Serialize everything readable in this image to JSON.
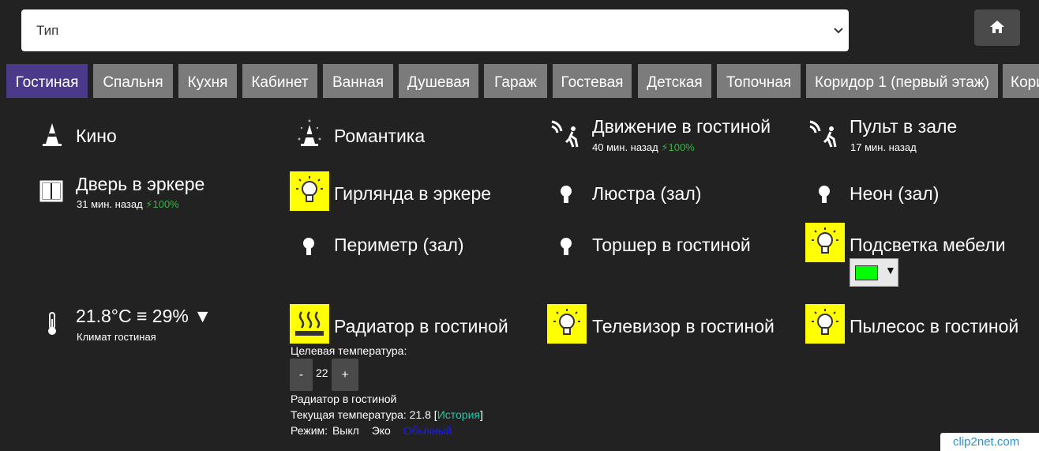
{
  "select": {
    "value": "Тип"
  },
  "tabs": [
    {
      "label": "Гостиная",
      "active": true
    },
    {
      "label": "Спальня"
    },
    {
      "label": "Кухня"
    },
    {
      "label": "Кабинет"
    },
    {
      "label": "Ванная"
    },
    {
      "label": "Душевая"
    },
    {
      "label": "Гараж"
    },
    {
      "label": "Гостевая"
    },
    {
      "label": "Детская"
    },
    {
      "label": "Топочная"
    },
    {
      "label": "Коридор 1 (первый этаж)"
    },
    {
      "label": "Кори"
    }
  ],
  "devices": {
    "kino": {
      "label": "Кино",
      "icon": "scene-cone-icon"
    },
    "romantika": {
      "label": "Романтика",
      "icon": "scene-cone-icon"
    },
    "motion_living": {
      "label": "Движение в гостиной",
      "time": "40 мин. назад",
      "battery": "100%",
      "icon": "motion-sensor-icon"
    },
    "remote_hall": {
      "label": "Пульт в зале",
      "time": "17 мин. назад",
      "icon": "motion-sensor-icon"
    },
    "door_bay": {
      "label": "Дверь в эркере",
      "time": "31 мин. назад",
      "battery": "100%",
      "icon": "door-icon"
    },
    "garland": {
      "label": "Гирлянда в эркере",
      "on": true,
      "icon": "bulb-icon"
    },
    "chandelier": {
      "label": "Люстра (зал)",
      "on": false,
      "icon": "bulb-icon"
    },
    "neon": {
      "label": "Неон (зал)",
      "on": false,
      "icon": "bulb-icon"
    },
    "perimeter": {
      "label": "Периметр (зал)",
      "on": false,
      "icon": "bulb-icon"
    },
    "floorlamp": {
      "label": "Торшер в гостиной",
      "on": false,
      "icon": "bulb-icon"
    },
    "furniture_light": {
      "label": "Подсветка мебели",
      "on": true,
      "color": "#00ff00",
      "icon": "bulb-icon"
    },
    "climate": {
      "label": "21.8°C ≡ 29% ▼",
      "sub": "Климат гостиная",
      "icon": "thermometer-icon"
    },
    "radiator": {
      "label": "Радиатор в гостиной",
      "on": true,
      "icon": "heater-icon",
      "target_label": "Целевая температура:",
      "minus": "-",
      "value": "22",
      "plus": "+",
      "name": "Радиатор в гостиной",
      "current_prefix": "Текущая температура: 21.8 [",
      "history": "История",
      "current_suffix": "]",
      "mode_label": "Режим:",
      "mode_off": "Выкл",
      "mode_eco": "Эко",
      "mode_normal": "Обычный"
    },
    "tv": {
      "label": "Телевизор в гостиной",
      "on": true,
      "icon": "bulb-icon"
    },
    "vacuum": {
      "label": "Пылесос в гостиной",
      "on": true,
      "icon": "bulb-icon"
    }
  },
  "watermark": "clip2net.com",
  "colors": {
    "active_tab": "#4b3a8a",
    "tab": "#7b7b7b",
    "on_icon": "#ffff00",
    "background": "#222222",
    "link_history": "#27c7a8",
    "link_mode": "#1a1aff",
    "battery": "#3cb043"
  }
}
